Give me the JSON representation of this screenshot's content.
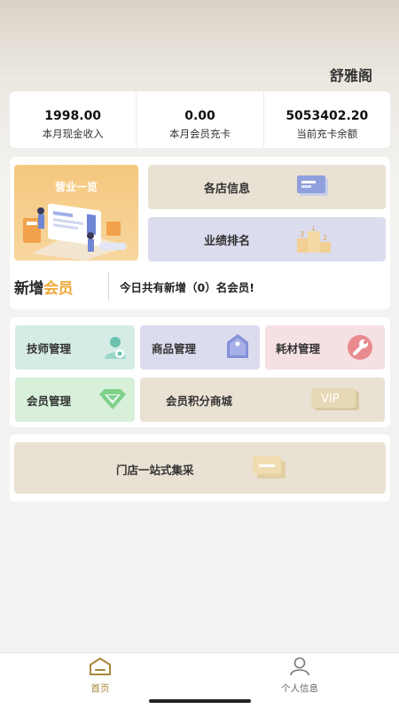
{
  "header": {
    "shop_name": "舒雅阁"
  },
  "stats": [
    {
      "value": "1998.00",
      "label": "本月现金收入"
    },
    {
      "value": "0.00",
      "label": "本月会员充卡"
    },
    {
      "value": "5053402.20",
      "label": "当前充卡余额"
    }
  ],
  "overview": {
    "title": "营业一览"
  },
  "store_info": {
    "label": "各店信息",
    "icon": "id-card-icon"
  },
  "ranking": {
    "label": "业绩排名",
    "icon": "podium-icon"
  },
  "new_member": {
    "logo_part1": "新增",
    "logo_part2": "会员",
    "text": "今日共有新增（0）名会员!"
  },
  "management": {
    "technician": {
      "label": "技师管理",
      "icon": "technician-icon",
      "bg": "#d5ece6"
    },
    "product": {
      "label": "商品管理",
      "icon": "tag-icon",
      "bg": "#dcdcef"
    },
    "consumable": {
      "label": "耗材管理",
      "icon": "wrench-icon",
      "bg": "#f5e1e3"
    },
    "member": {
      "label": "会员管理",
      "icon": "diamond-icon",
      "bg": "#d8efd9"
    },
    "points_mall": {
      "label": "会员积分商城",
      "icon_text": "VIP",
      "icon": "vip-icon",
      "bg": "#e9e1d3"
    }
  },
  "purchase": {
    "label": "门店一站式集采",
    "icon": "card-icon"
  },
  "tabbar": {
    "home": {
      "label": "首页",
      "icon": "home-icon"
    },
    "profile": {
      "label": "个人信息",
      "icon": "user-icon"
    }
  },
  "colors": {
    "accent": "#a8863a",
    "overview_bg": "#f5c77e"
  }
}
